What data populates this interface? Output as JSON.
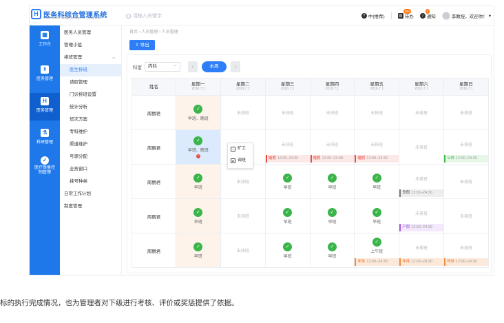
{
  "header": {
    "logo_icon": "hospital-h-icon",
    "title": "医务科综合管理系统",
    "subtitle": "comprehensive management system of medical affairs",
    "search_placeholder": "请输入关键字",
    "help_label": "中(推荐)",
    "todo_label": "待办",
    "todo_badge": "99+",
    "notice_label": "通知",
    "notice_badge": "5",
    "user_label": "李教授，欢迎你！"
  },
  "primary_nav": [
    {
      "label": "工作台",
      "icon": "grid-icon"
    },
    {
      "label": "医务管理",
      "icon": "doctor-icon"
    },
    {
      "label": "医务管理",
      "icon": "hospital-icon"
    },
    {
      "label": "科研管理",
      "icon": "microscope-icon"
    },
    {
      "label": "医疗质量控制管理",
      "icon": "shield-icon"
    }
  ],
  "secondary_nav": {
    "items": [
      {
        "label": "医务人员管理"
      },
      {
        "label": "管理小组"
      },
      {
        "label": "排班管理"
      },
      {
        "label": "医生排班"
      },
      {
        "label": "请假管理"
      },
      {
        "label": "门诊排班设置"
      },
      {
        "label": "统计分析"
      },
      {
        "label": "班次方案"
      },
      {
        "label": "专科维护"
      },
      {
        "label": "渠道维护"
      },
      {
        "label": "号源分配"
      },
      {
        "label": "业务窗口"
      },
      {
        "label": "挂号种类"
      },
      {
        "label": "日常工作计划"
      },
      {
        "label": "制度管理"
      }
    ],
    "active": "医生排班"
  },
  "breadcrumb": "首页 › 人员管理 › 人员管理",
  "toolbar": {
    "export_label": "导出"
  },
  "filters": {
    "dept_label": "科室",
    "dept_value": "内科",
    "this_week_label": "本周"
  },
  "schedule": {
    "name_header": "姓名",
    "days": [
      {
        "label": "星期一",
        "date": "2016.7.1"
      },
      {
        "label": "星期二",
        "date": "2016.7.1"
      },
      {
        "label": "星期三",
        "date": "2016.7.1"
      },
      {
        "label": "星期四",
        "date": "2016.7.1"
      },
      {
        "label": "星期五",
        "date": "2016.7.1"
      },
      {
        "label": "星期六",
        "date": "2016.7.1"
      },
      {
        "label": "星期日",
        "date": "2016.7.1"
      }
    ],
    "unscheduled": "未排班",
    "rows": [
      {
        "name": "周丽君",
        "cells": [
          {
            "shift": "早班、晚班"
          },
          {},
          {},
          {},
          {},
          {},
          {}
        ]
      },
      {
        "name": "周丽君",
        "cells": [
          {
            "shift": "早班、晚班"
          },
          {},
          {
            "tag": "婚假",
            "time": "12:00–24:30",
            "color": "red"
          },
          {
            "tag": "婚假",
            "time": "12:00–24:30",
            "color": "red"
          },
          {
            "tag": "婚假",
            "time": "12:00–24:30",
            "color": "red"
          },
          {},
          {
            "tag": "公休",
            "time": "12:00–24:30",
            "color": "green"
          }
        ]
      },
      {
        "name": "周丽君",
        "cells": [
          {
            "shift": "早班"
          },
          {},
          {
            "shift": "早班"
          },
          {
            "shift": "早班"
          },
          {
            "shift": "早班"
          },
          {
            "tag": "丧假",
            "time": "12:00–24:30",
            "color": "gray"
          },
          {}
        ]
      },
      {
        "name": "周丽君",
        "cells": [
          {
            "shift": "早班"
          },
          {},
          {
            "shift": "早班"
          },
          {
            "shift": "早班"
          },
          {
            "shift": "早班"
          },
          {
            "tag": "产假",
            "time": "12:00–24:30",
            "color": "purple"
          },
          {}
        ]
      },
      {
        "name": "周丽君",
        "cells": [
          {
            "shift": "早班"
          },
          {},
          {
            "shift": "早班"
          },
          {
            "shift": "早班"
          },
          {
            "shift": "上午班",
            "tag": "年休",
            "time": "12:00–24:30",
            "color": "orange"
          },
          {
            "tag": "年休",
            "time": "12:00–24:30",
            "color": "orange"
          },
          {
            "tag": "年休",
            "time": "12:00–24:30",
            "color": "orange"
          }
        ]
      }
    ]
  },
  "context_menu": {
    "items": [
      {
        "label": "旷工",
        "icon": "absent-icon"
      },
      {
        "label": "调班",
        "icon": "swap-icon"
      }
    ]
  },
  "caption": "标的执行完成情况，也为管理者对下级进行考核、评价或奖惩提供了依据。",
  "colors": {
    "primary": "#2d7ef7",
    "sidebar": "#1e78ea",
    "ok": "#3bb54a"
  }
}
